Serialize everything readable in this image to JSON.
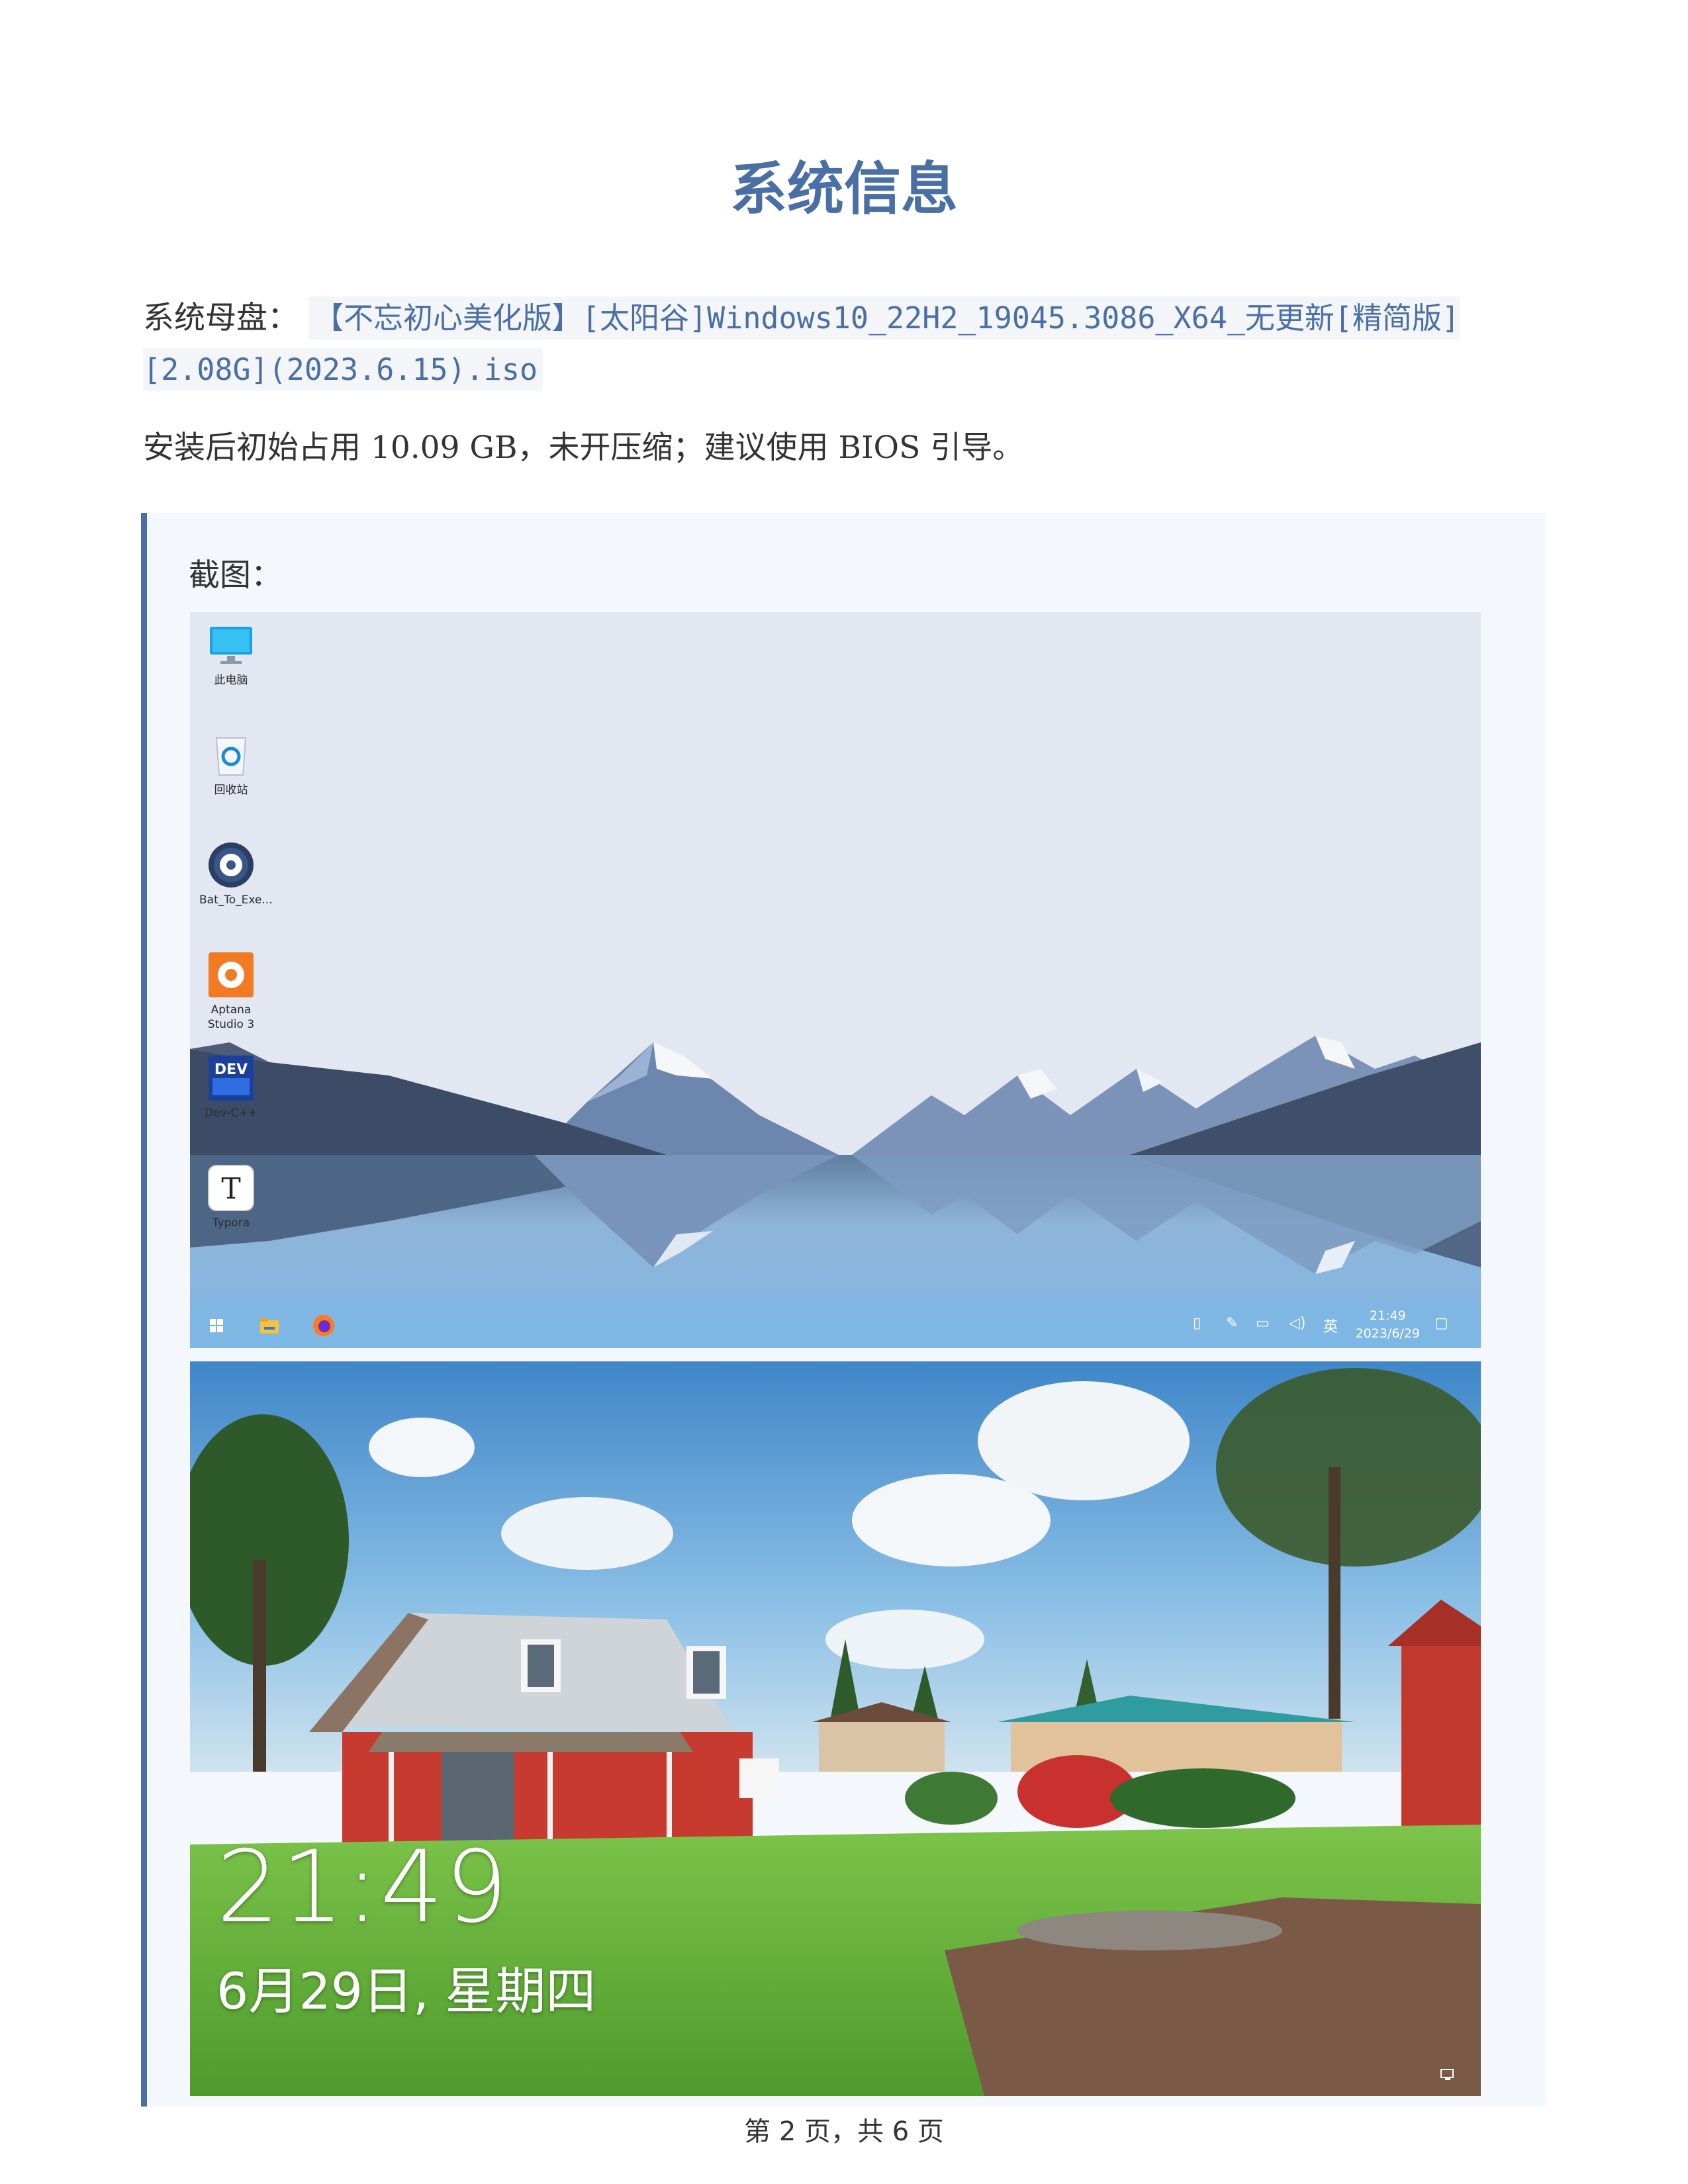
{
  "document": {
    "title": "系统信息",
    "mother_disk_label": "系统母盘：",
    "mother_disk_file": "【不忘初心美化版】[太阳谷]Windows10_22H2_19045.3086_X64_无更新[精简版][2.08G](2023.6.15).iso",
    "install_note": "安装后初始占用 10.09 GB，未开压缩；建议使用 BIOS 引导。",
    "screenshot_label": "截图：",
    "footer": "第 2 页，共 6 页"
  },
  "desktop": {
    "icons": [
      {
        "label": "此电脑",
        "icon": "monitor-icon"
      },
      {
        "label": "回收站",
        "icon": "recycle-bin-icon"
      },
      {
        "label": "Bat_To_Exe...",
        "icon": "gear-icon"
      },
      {
        "label": "Aptana Studio 3",
        "icon": "aptana-gear-icon"
      },
      {
        "label": "Dev-C++",
        "icon": "devcpp-icon"
      },
      {
        "label": "Typora",
        "icon": "typora-icon"
      }
    ],
    "taskbar": {
      "ime": "英",
      "time": "21:49",
      "date": "2023/6/29"
    }
  },
  "lockscreen": {
    "time": "21:49",
    "date": "6月29日, 星期四"
  }
}
